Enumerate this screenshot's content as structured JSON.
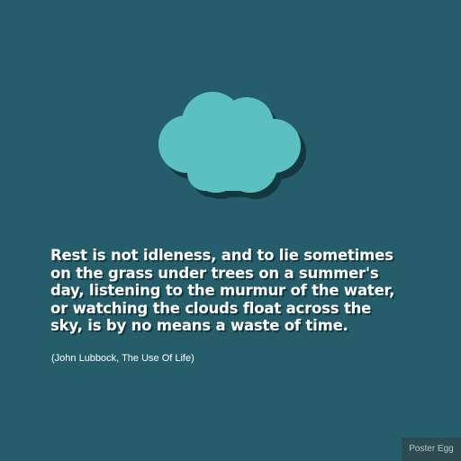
{
  "colors": {
    "background": "#255e6a",
    "cloud": "#5cc0c0",
    "shadow": "#133840",
    "text": "#ffffff"
  },
  "illustration": {
    "icon": "cloud-icon"
  },
  "quote": {
    "lines": [
      "Rest is not idleness, and to lie sometimes",
      "on the grass under trees on a summer's",
      "day, listening to the murmur of the water,",
      "or watching the clouds float across the",
      "sky, is by no means a waste of time."
    ],
    "attribution": "(John Lubbock, The Use Of Life)"
  },
  "watermark": {
    "label": "Poster Egg"
  }
}
